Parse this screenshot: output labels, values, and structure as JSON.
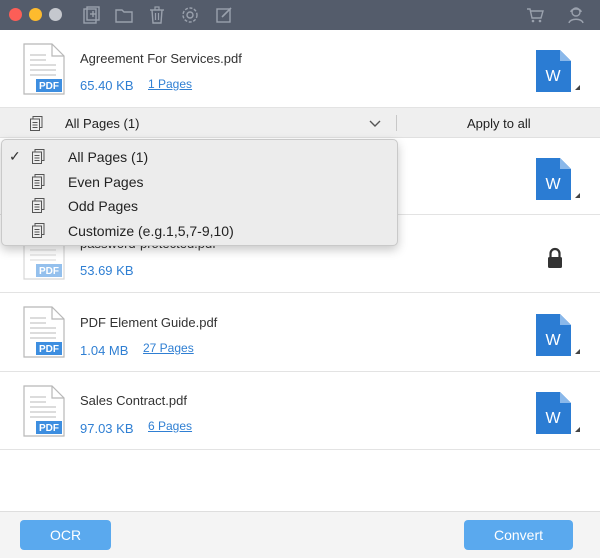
{
  "toolbar": {
    "icons": [
      "add-file-icon",
      "folder-icon",
      "trash-icon",
      "settings-icon",
      "edit-icon",
      "cart-icon",
      "account-icon"
    ]
  },
  "files": [
    {
      "name": "Agreement For Services.pdf",
      "size": "65.40 KB",
      "pages": "1 Pages",
      "output": "word"
    },
    {
      "name": "",
      "size": "",
      "pages": "",
      "output": "word"
    },
    {
      "name": "password-protected.pdf",
      "size": "53.69 KB",
      "pages": "",
      "output": "locked"
    },
    {
      "name": "PDF Element Guide.pdf",
      "size": "1.04 MB",
      "pages": "27 Pages",
      "output": "word"
    },
    {
      "name": "Sales Contract.pdf",
      "size": "97.03 KB",
      "pages": "6 Pages",
      "output": "word"
    }
  ],
  "page_select": {
    "selected": "All Pages (1)",
    "apply_label": "Apply to all",
    "options": [
      {
        "label": "All Pages (1)",
        "checked": true
      },
      {
        "label": "Even Pages",
        "checked": false
      },
      {
        "label": "Odd Pages",
        "checked": false
      },
      {
        "label": "Customize (e.g.1,5,7-9,10)",
        "checked": false
      }
    ],
    "check_mark": "✓"
  },
  "badges": {
    "pdf": "PDF",
    "word": "W"
  },
  "buttons": {
    "ocr": "OCR",
    "convert": "Convert"
  },
  "colors": {
    "accent": "#2f7fd3",
    "button": "#5aa9ee",
    "word": "#2b7cd3",
    "titlebar": "#545c6b"
  }
}
